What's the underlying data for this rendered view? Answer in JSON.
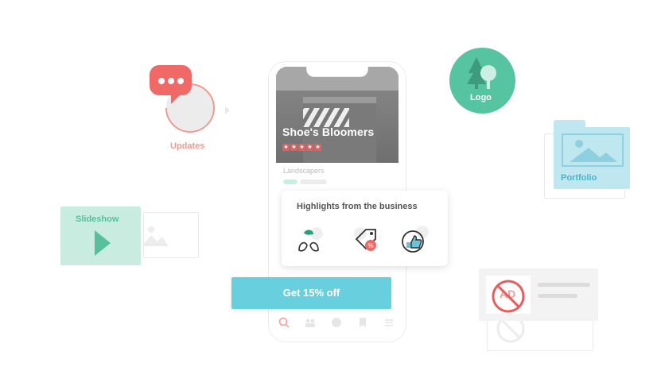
{
  "phone": {
    "business_name": "Shoe's Bloomers",
    "rating_stars": 5,
    "category": "Landscapers",
    "highlights_title": "Highlights from the business",
    "highlight_icons": [
      "eco-leaf-hands-icon",
      "discount-tag-icon",
      "thumbs-up-icon"
    ],
    "bottom_nav_icons": [
      "search-icon",
      "people-icon",
      "profile-icon",
      "bookmark-icon",
      "menu-icon"
    ]
  },
  "cta": {
    "label": "Get 15% off"
  },
  "features": {
    "updates": {
      "label": "Updates",
      "icon": "chat-bubble-icon"
    },
    "logo": {
      "label": "Logo",
      "icon": "tree-icon"
    },
    "portfolio": {
      "label": "Portfolio",
      "icon": "image-icon"
    },
    "slideshow": {
      "label": "Slideshow",
      "icon": "play-icon"
    },
    "no_ads": {
      "badge_text": "AD",
      "icon": "no-ads-icon"
    }
  },
  "colors": {
    "accent_red": "#ea5b5b",
    "cta_teal": "#67cfde",
    "logo_green": "#56c4a0",
    "portfolio_blue": "#bfe7f0",
    "slideshow_mint": "#c8ece0"
  }
}
